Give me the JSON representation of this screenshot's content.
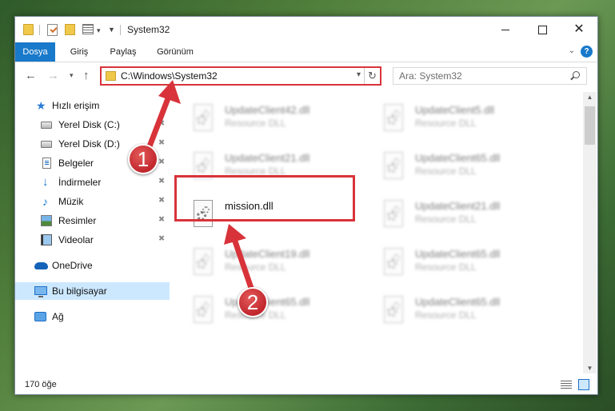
{
  "window": {
    "title": "System32",
    "controls": {
      "minimize": "",
      "maximize": "",
      "close": "✕"
    }
  },
  "ribbon": {
    "tabs": [
      "Dosya",
      "Giriş",
      "Paylaş",
      "Görünüm"
    ],
    "help": "?"
  },
  "nav": {
    "back": "←",
    "forward": "→",
    "recent": "▾",
    "up": "↑",
    "address": "C:\\Windows\\System32",
    "address_dropdown": "▾",
    "refresh": "↻",
    "search_placeholder": "Ara: System32"
  },
  "sidebar": {
    "items": [
      {
        "label": "Hızlı erişim",
        "icon": "quick-access-star-icon"
      },
      {
        "label": "Yerel Disk (C:)",
        "icon": "drive-icon",
        "pinned": true
      },
      {
        "label": "Yerel Disk (D:)",
        "icon": "drive-icon",
        "pinned": true
      },
      {
        "label": "Belgeler",
        "icon": "documents-icon",
        "pinned": true
      },
      {
        "label": "İndirmeler",
        "icon": "downloads-icon",
        "pinned": true
      },
      {
        "label": "Müzik",
        "icon": "music-icon",
        "pinned": true
      },
      {
        "label": "Resimler",
        "icon": "pictures-icon",
        "pinned": true
      },
      {
        "label": "Videolar",
        "icon": "videos-icon",
        "pinned": true
      },
      {
        "label": "OneDrive",
        "icon": "onedrive-icon"
      },
      {
        "label": "Bu bilgisayar",
        "icon": "this-pc-icon",
        "selected": true
      },
      {
        "label": "Ağ",
        "icon": "network-icon"
      }
    ],
    "pin_glyph": "📌"
  },
  "files": {
    "highlighted": {
      "name": "mission.dll",
      "type": ""
    },
    "left_column": [
      {
        "name": "UpdateClient42.dll",
        "type": "Resource DLL"
      },
      {
        "name": "UpdateClient21.dll",
        "type": "Resource DLL"
      },
      {
        "name": "mission.dll",
        "type": ""
      },
      {
        "name": "UpdateClient19.dll",
        "type": "Resource DLL"
      },
      {
        "name": "UpdateClient65.dll",
        "type": "Resource DLL"
      }
    ],
    "right_column": [
      {
        "name": "UpdateClient5.dll",
        "type": "Resource DLL"
      },
      {
        "name": "UpdateClient65.dll",
        "type": "Resource DLL"
      },
      {
        "name": "UpdateClient21.dll",
        "type": "Resource DLL"
      },
      {
        "name": "UpdateClient65.dll",
        "type": "Resource DLL"
      },
      {
        "name": "UpdateClient65.dll",
        "type": "Resource DLL"
      }
    ]
  },
  "scrollbar": {
    "up": "▲",
    "down": "▼"
  },
  "status": {
    "item_count": "170 öğe"
  },
  "callouts": [
    {
      "number": "1"
    },
    {
      "number": "2"
    }
  ],
  "colors": {
    "accent": "#1979ca",
    "highlight_border": "#d8333a",
    "selected_nav": "#cce8ff"
  }
}
